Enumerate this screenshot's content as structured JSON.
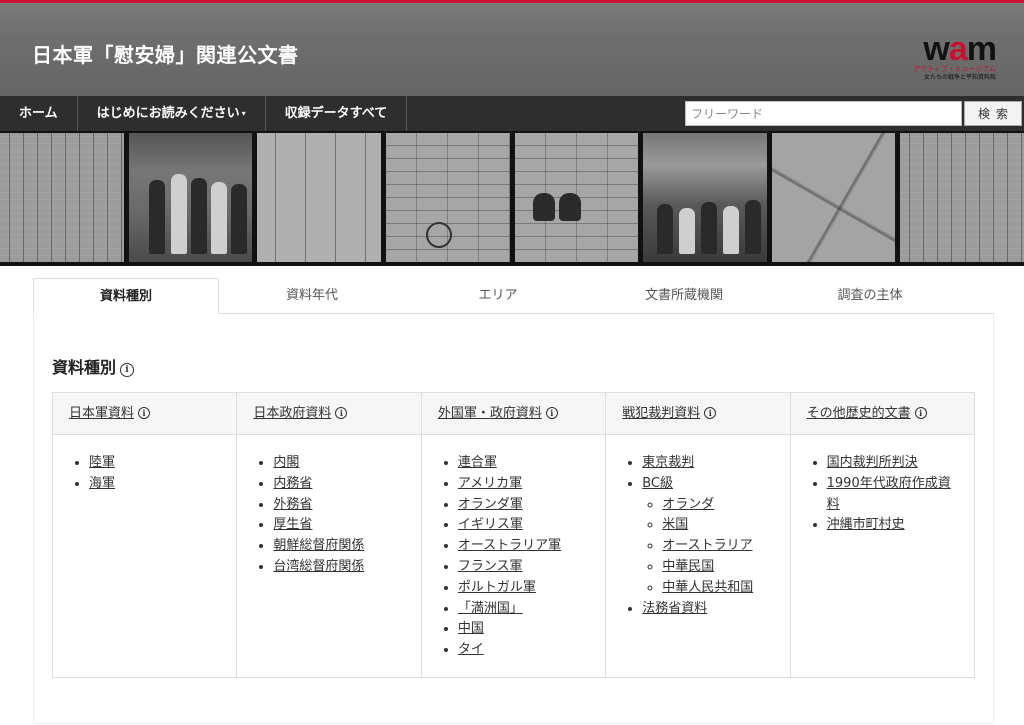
{
  "header": {
    "site_title": "日本軍「慰安婦」関連公文書",
    "logo": {
      "word_prefix": "w",
      "word_accent": "a",
      "word_suffix": "m",
      "sub1": "アクティブ・ミュージアム",
      "sub2": "女たちの戦争と平和資料館"
    }
  },
  "nav": {
    "items": [
      {
        "label": "ホーム"
      },
      {
        "label": "はじめにお読みください",
        "caret": "▾"
      },
      {
        "label": "収録データすべて"
      }
    ],
    "search_placeholder": "フリーワード",
    "search_button": "検索"
  },
  "tabs": [
    {
      "label": "資料種別",
      "active": true
    },
    {
      "label": "資料年代"
    },
    {
      "label": "エリア"
    },
    {
      "label": "文書所蔵機関"
    },
    {
      "label": "調査の主体"
    }
  ],
  "panel": {
    "title": "資料種別",
    "info_glyph": "i",
    "columns": [
      {
        "title": "日本軍資料",
        "items": [
          "陸軍",
          "海軍"
        ]
      },
      {
        "title": "日本政府資料",
        "items": [
          "内閣",
          "内務省",
          "外務省",
          "厚生省",
          "朝鮮総督府関係",
          "台湾総督府関係"
        ]
      },
      {
        "title": "外国軍・政府資料",
        "items": [
          "連合軍",
          "アメリカ軍",
          "オランダ軍",
          "イギリス軍",
          "オーストラリア軍",
          "フランス軍",
          "ポルトガル軍",
          "「満洲国」",
          "中国",
          "タイ"
        ]
      },
      {
        "title": "戦犯裁判資料",
        "items": [
          "東京裁判",
          "BC級"
        ],
        "sub_items": [
          "オランダ",
          "米国",
          "オーストラリア",
          "中華民国",
          "中華人民共和国"
        ],
        "items_after": [
          "法務省資料"
        ]
      },
      {
        "title": "その他歴史的文書",
        "items": [
          "国内裁判所判決",
          "1990年代政府作成資料",
          "沖縄市町村史"
        ]
      }
    ]
  },
  "colors": {
    "accent": "#c8102e",
    "nav_bg": "#2e2e2e",
    "header_bg": "#6e6e6e"
  }
}
